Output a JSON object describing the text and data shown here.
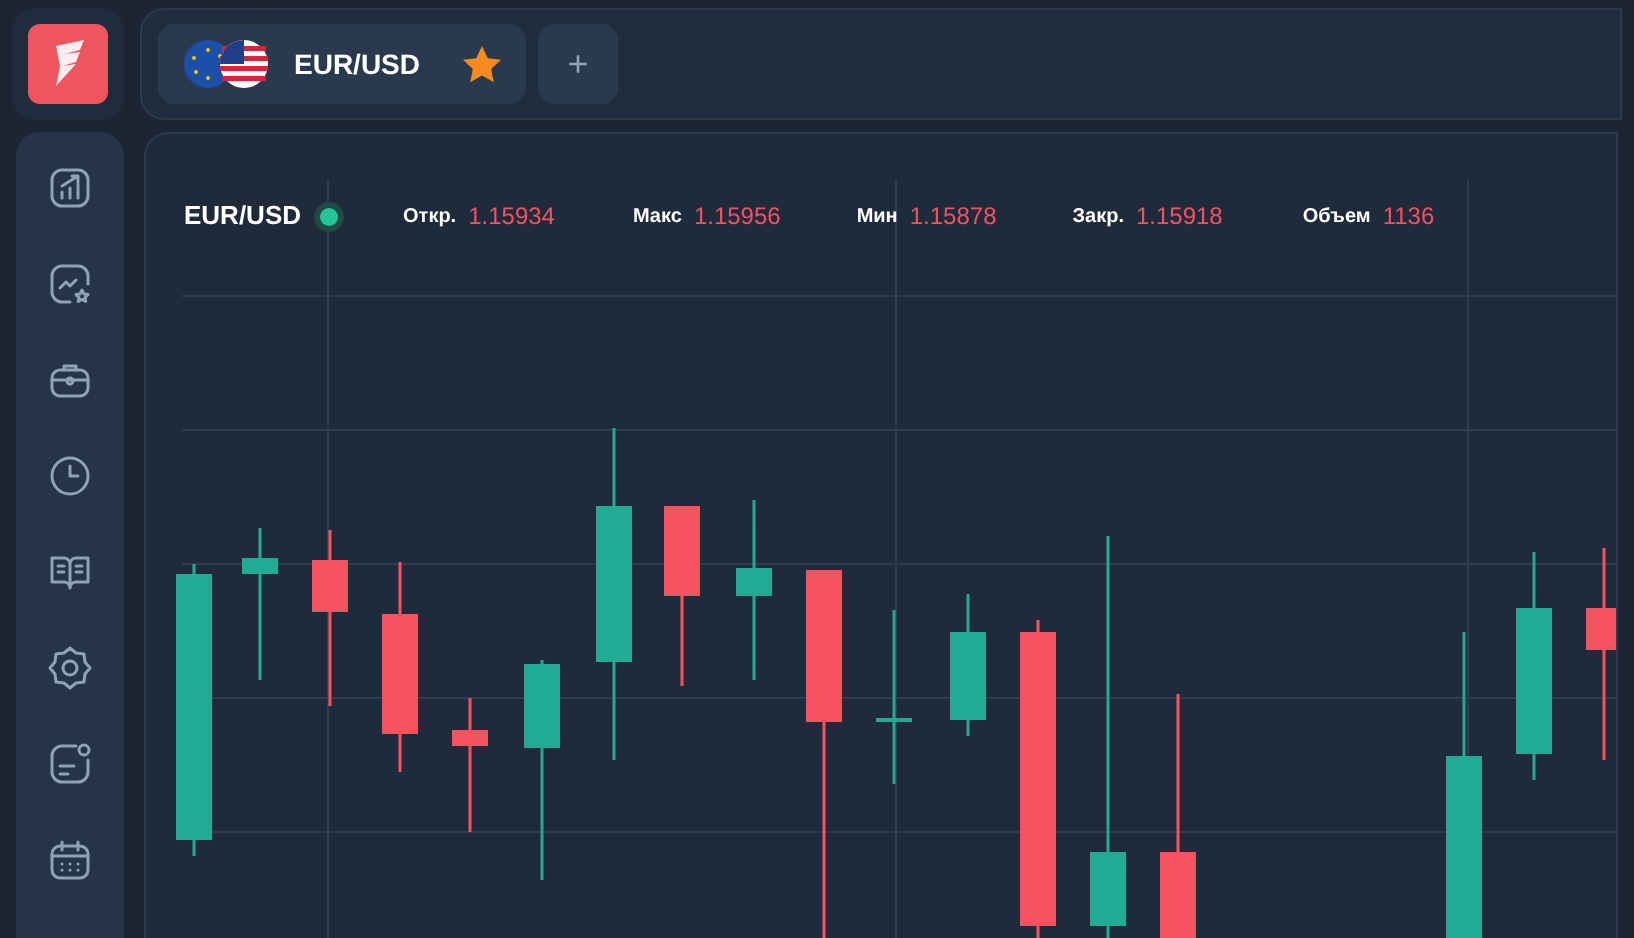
{
  "tabs": [
    {
      "label": "EUR/USD",
      "selected": true,
      "favorite": true
    }
  ],
  "add_tab": {
    "label": "+"
  },
  "chart": {
    "symbol": "EUR/USD",
    "live": true,
    "stats": [
      {
        "label": "Откр.",
        "value": "1.15934"
      },
      {
        "label": "Макс",
        "value": "1.15956"
      },
      {
        "label": "Мин",
        "value": "1.15878"
      },
      {
        "label": "Закр.",
        "value": "1.15918"
      },
      {
        "label": "Объем",
        "value": "1136"
      }
    ]
  }
}
